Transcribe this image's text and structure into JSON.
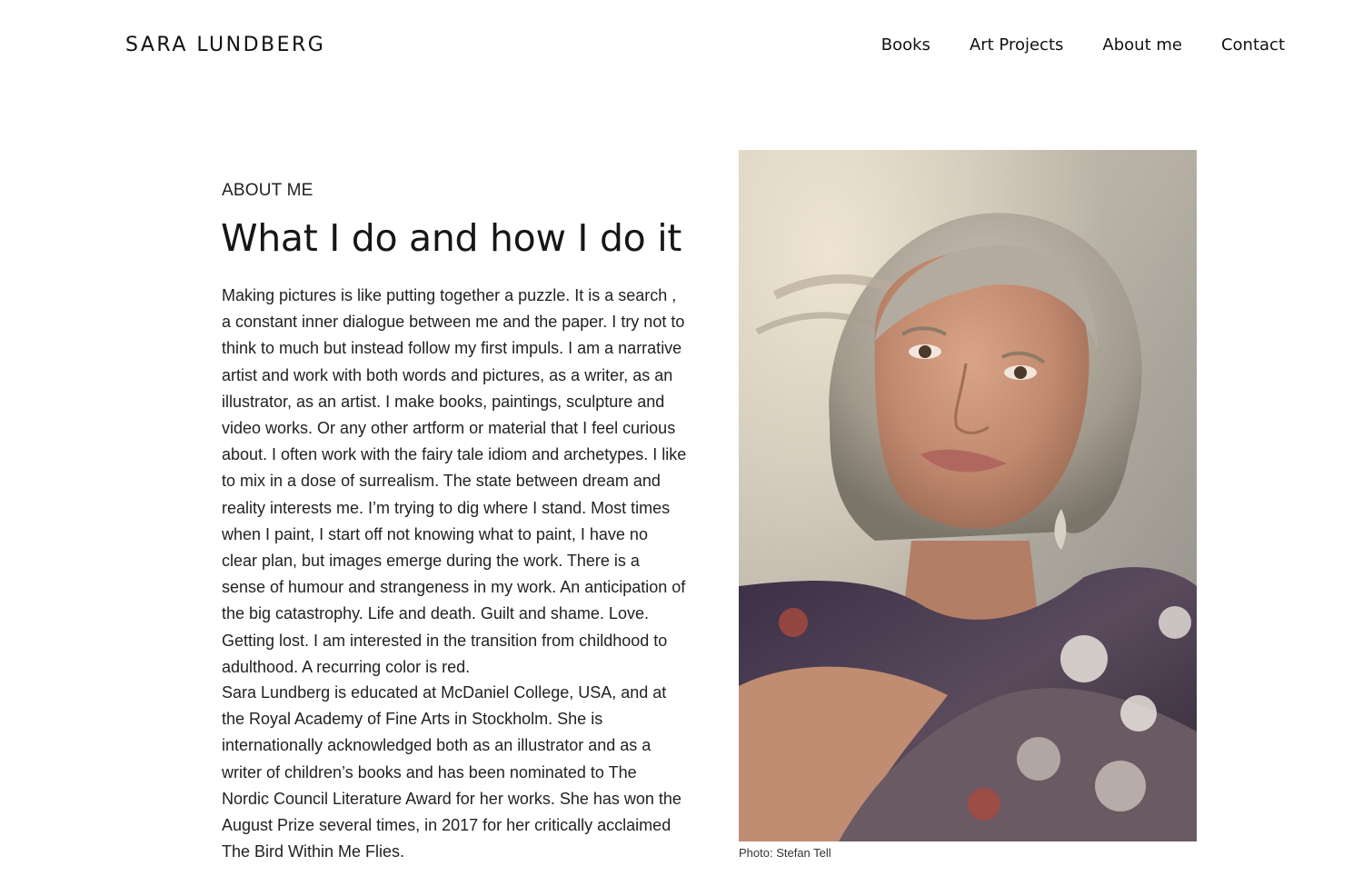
{
  "header": {
    "logo": "SARA LUNDBERG",
    "nav": [
      {
        "label": "Books"
      },
      {
        "label": "Art Projects"
      },
      {
        "label": "About me"
      },
      {
        "label": "Contact"
      }
    ]
  },
  "about": {
    "eyebrow": "ABOUT ME",
    "title": "What I do and how I do it",
    "paragraphs": [
      "Making pictures is like putting together a puzzle. It is a search , a constant inner dialogue between me and the paper. I try not to think to much but instead follow my first impuls. I am a narrative artist and work with both words and pictures, as a writer, as an illustrator, as an artist. I make books, paintings, sculpture and video works. Or any other artform or material that I feel curious about. I often work with the fairy tale idiom and archetypes. I like to mix in a dose of surrealism. The state between dream and reality interests me. I’m trying to dig where I stand. Most times when I paint, I start off not knowing what to paint, I have no clear plan, but images emerge during the work. There is a sense of humour and strangeness in my work. An anticipation of the big catastrophy. Life and death. Guilt and shame. Love. Getting lost. I am interested in the transition from childhood to adulthood. A recurring color is red.",
      "Sara Lundberg is educated at McDaniel College, USA, and at the Royal Academy of Fine Arts in Stockholm. She is internationally acknowledged both as an illustrator and as a writer of children’s books and has been nominated to The Nordic Council Literature Award for her works. She has won the August Prize several times, in 2017 for her critically acclaimed The Bird Within Me Flies."
    ],
    "photo_credit": "Photo: Stefan Tell"
  }
}
